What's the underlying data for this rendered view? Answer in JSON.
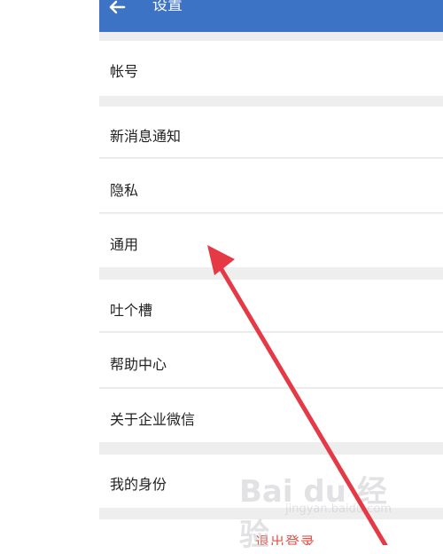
{
  "header": {
    "title": "设置",
    "back_icon": "arrow-left-icon",
    "color": "#3c73c4"
  },
  "menu": {
    "account": "帐号",
    "notifications": "新消息通知",
    "privacy": "隐私",
    "general": "通用",
    "feedback": "吐个槽",
    "help": "帮助中心",
    "about": "关于企业微信",
    "identity": "我的身份"
  },
  "logout_label": "退出登录",
  "watermark": {
    "brand": "Bai du 经验",
    "url": "jingyan.baidu.com"
  },
  "annotation": {
    "arrow_color": "#e53946"
  }
}
